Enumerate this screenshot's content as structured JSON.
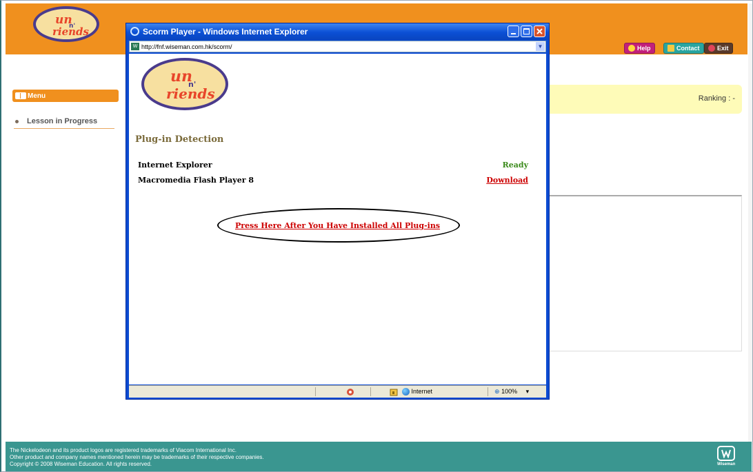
{
  "header": {
    "logo_text": {
      "line1": "un",
      "line2": "n'",
      "line3": "riends"
    },
    "buttons": {
      "help": "Help",
      "contact": "Contact",
      "exit": "Exit"
    }
  },
  "sidebar": {
    "menu_label": "Menu",
    "items": [
      {
        "label": "Lesson in Progress"
      }
    ]
  },
  "main": {
    "ranking_label": "Ranking : -"
  },
  "footer": {
    "line1": "The Nickelodeon and its product logos are registered trademarks of Viacom International Inc.",
    "line2": "Other product and company names mentioned herein may be trademarks of their respective companies.",
    "line3": "Copyright © 2008 Wiseman Education. All rights reserved.",
    "brand_caption": "Wiseman"
  },
  "popup": {
    "window_title": "Scorm Player - Windows Internet Explorer",
    "address": "http://fnf.wiseman.com.hk/scorm/",
    "section_title": "Plug-in Detection",
    "plugins": [
      {
        "name": "Internet Explorer",
        "status": "Ready"
      },
      {
        "name": "Macromedia Flash Player 8",
        "status": "Download"
      }
    ],
    "press_link": "Press Here After You Have Installed All Plug-ins",
    "status_zone": "Internet",
    "zoom": "100%"
  },
  "colors": {
    "header_orange": "#f0901e",
    "footer_teal": "#3a9690",
    "rank_yellow": "#fefbb8",
    "link_red": "#cc0000",
    "ready_green": "#3a8a1a",
    "xp_blue": "#0c4bd1"
  }
}
